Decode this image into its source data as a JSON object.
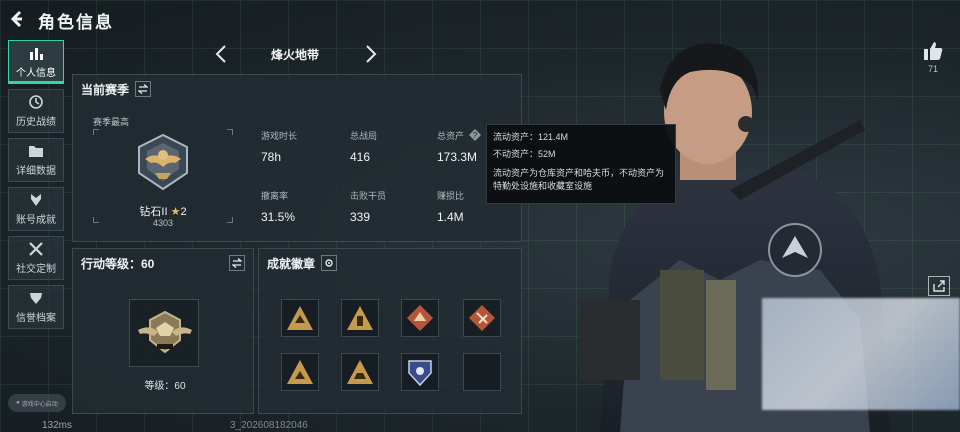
{
  "header": {
    "title": "角色信息"
  },
  "nav": {
    "items": [
      {
        "label": "个人信息",
        "icon": "bar-chart-icon",
        "active": true
      },
      {
        "label": "历史战绩",
        "icon": "history-icon"
      },
      {
        "label": "详细数据",
        "icon": "folder-icon"
      },
      {
        "label": "账号成就",
        "icon": "medal-icon"
      },
      {
        "label": "社交定制",
        "icon": "tools-icon"
      },
      {
        "label": "信誉档案",
        "icon": "shield-icon"
      }
    ],
    "footer_label": "游戏中心启动"
  },
  "mode": {
    "label": "烽火地带"
  },
  "season": {
    "title": "当前赛季",
    "subtitle": "赛季最高",
    "rank_name": "钻石II",
    "rank_stars": "2",
    "rank_score": "4303",
    "stats": [
      {
        "label": "游戏时长",
        "value": "78h"
      },
      {
        "label": "总战局",
        "value": "416"
      },
      {
        "label": "总资产",
        "value": "173.3M"
      },
      {
        "label": "撤离率",
        "value": "31.5%"
      },
      {
        "label": "击败干员",
        "value": "339"
      },
      {
        "label": "赚损比",
        "value": "1.4M"
      }
    ]
  },
  "tooltip": {
    "line1": "流动资产：121.4M",
    "line2": "不动资产：52M",
    "line3": "流动资产为仓库资产和哈夫币，不动资产为特勤处设施和收藏室设施"
  },
  "action_level": {
    "title": "行动等级：60",
    "level_text": "等级：60"
  },
  "achievements": {
    "title": "成就徽章"
  },
  "social": {
    "likes": "71"
  },
  "status": {
    "ping": "132ms",
    "uid": "3_202608182046"
  },
  "colors": {
    "accent": "#2fd7a8",
    "panel": "#222c32",
    "gold": "#c9a45a"
  }
}
